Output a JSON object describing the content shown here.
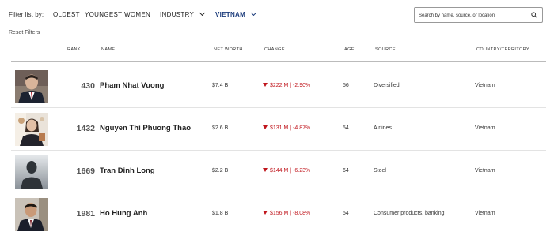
{
  "filters": {
    "label": "Filter list by:",
    "options": [
      {
        "label": "OLDEST"
      },
      {
        "label": "YOUNGEST"
      },
      {
        "label": "WOMEN"
      },
      {
        "label": "INDUSTRY"
      },
      {
        "label": "VIETNAM"
      }
    ],
    "reset_label": "Reset Filters"
  },
  "search": {
    "placeholder": "Search by name, source, or location"
  },
  "table": {
    "headers": {
      "rank": "RANK",
      "name": "NAME",
      "net_worth": "NET WORTH",
      "change": "CHANGE",
      "age": "AGE",
      "source": "SOURCE",
      "country": "COUNTRY/TERRITORY"
    },
    "rows": [
      {
        "rank": "430",
        "name": "Pham Nhat Vuong",
        "net_worth": "$7.4 B",
        "change": "$222 M | -2.90%",
        "age": "56",
        "source": "Diversified",
        "country": "Vietnam"
      },
      {
        "rank": "1432",
        "name": "Nguyen Thi Phuong Thao",
        "net_worth": "$2.6 B",
        "change": "$131 M | -4.87%",
        "age": "54",
        "source": "Airlines",
        "country": "Vietnam"
      },
      {
        "rank": "1669",
        "name": "Tran Dinh Long",
        "net_worth": "$2.2 B",
        "change": "$144 M | -6.23%",
        "age": "64",
        "source": "Steel",
        "country": "Vietnam"
      },
      {
        "rank": "1981",
        "name": "Ho Hung Anh",
        "net_worth": "$1.8 B",
        "change": "$156 M | -8.08%",
        "age": "54",
        "source": "Consumer products, banking",
        "country": "Vietnam"
      }
    ]
  },
  "colors": {
    "active_filter": "#1a3a7a",
    "negative_change": "#c0161d"
  }
}
